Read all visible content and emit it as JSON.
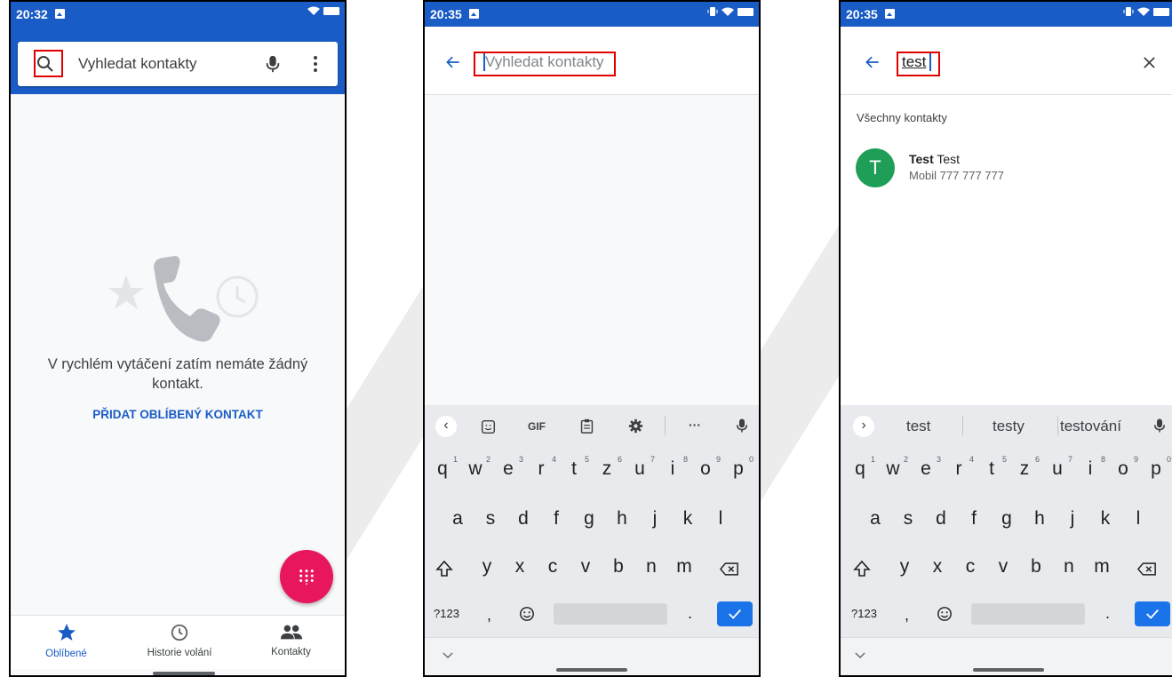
{
  "screen1": {
    "time": "20:32",
    "search_placeholder": "Vyhledat kontakty",
    "empty_text": "V rychlém vytáčení zatím nemáte žádný kontakt.",
    "add_favorite": "PŘIDAT OBLÍBENÝ KONTAKT",
    "tabs": [
      {
        "label": "Oblíbené",
        "icon": "star-icon",
        "active": true
      },
      {
        "label": "Historie volání",
        "icon": "clock-icon",
        "active": false
      },
      {
        "label": "Kontakty",
        "icon": "people-icon",
        "active": false
      }
    ],
    "colors": {
      "header": "#1a5cc6",
      "fab": "#e8175d",
      "accent": "#1a5cc6"
    }
  },
  "screen2": {
    "time": "20:35",
    "search_placeholder": "Vyhledat kontakty",
    "kb_toolbar": [
      "gif_label"
    ],
    "gif_label": "GIF",
    "more_label": "···"
  },
  "screen3": {
    "time": "20:35",
    "query": "test",
    "section_title": "Všechny kontakty",
    "contact": {
      "initial": "T",
      "name_bold": "Test",
      "name_rest": " Test",
      "detail": "Mobil 777 777 777",
      "avatar_color": "#1e9e57"
    },
    "suggestions": [
      "test",
      "testy",
      "testování"
    ]
  },
  "keyboard": {
    "row1": [
      [
        "q",
        "1"
      ],
      [
        "w",
        "2"
      ],
      [
        "e",
        "3"
      ],
      [
        "r",
        "4"
      ],
      [
        "t",
        "5"
      ],
      [
        "z",
        "6"
      ],
      [
        "u",
        "7"
      ],
      [
        "i",
        "8"
      ],
      [
        "o",
        "9"
      ],
      [
        "p",
        "0"
      ]
    ],
    "row2": [
      "a",
      "s",
      "d",
      "f",
      "g",
      "h",
      "j",
      "k",
      "l"
    ],
    "row3": [
      "y",
      "x",
      "c",
      "v",
      "b",
      "n",
      "m"
    ],
    "symbols_label": "?123",
    "comma": ",",
    "period": "."
  }
}
